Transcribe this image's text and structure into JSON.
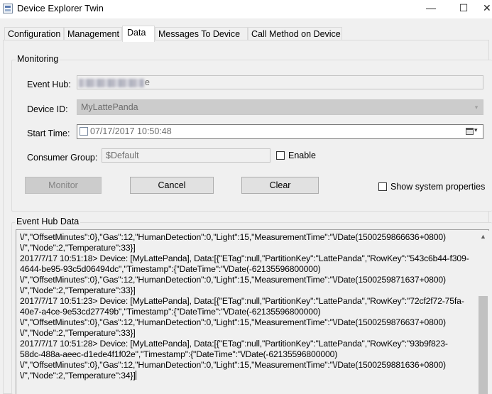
{
  "window": {
    "title": "Device Explorer Twin",
    "minimize": "—",
    "maximize": "☐",
    "close": "✕"
  },
  "tabs": [
    {
      "label": "Configuration",
      "active": false
    },
    {
      "label": "Management",
      "active": false
    },
    {
      "label": "Data",
      "active": true
    },
    {
      "label": "Messages To Device",
      "active": false
    },
    {
      "label": "Call Method on Device",
      "active": false
    }
  ],
  "monitoring": {
    "group_title": "Monitoring",
    "event_hub_label": "Event Hub:",
    "event_hub_value_suffix": "e",
    "device_id_label": "Device ID:",
    "device_id_value": "MyLattePanda",
    "start_time_label": "Start Time:",
    "start_time_value": "07/17/2017 10:50:48",
    "start_time_checked": false,
    "consumer_group_label": "Consumer Group:",
    "consumer_group_value": "$Default",
    "enable_label": "Enable",
    "enable_checked": false,
    "monitor_button": "Monitor",
    "cancel_button": "Cancel",
    "clear_button": "Clear",
    "show_system_properties_label": "Show system properties",
    "show_system_properties_checked": false
  },
  "event_hub_data": {
    "group_title": "Event Hub Data",
    "lines": [
      "\\/\",\"OffsetMinutes\":0},\"Gas\":12,\"HumanDetection\":0,\"Light\":15,\"MeasurementTime\":\"\\/Date(1500259866636+0800)",
      "\\/\",\"Node\":2,\"Temperature\":33}]",
      "2017/7/17 10:51:18> Device: [MyLattePanda], Data:[{\"ETag\":null,\"PartitionKey\":\"LattePanda\",\"RowKey\":\"543c6b44-f309-",
      "4644-be95-93c5d06494dc\",\"Timestamp\":{\"DateTime\":\"\\/Date(-62135596800000)",
      "\\/\",\"OffsetMinutes\":0},\"Gas\":12,\"HumanDetection\":0,\"Light\":15,\"MeasurementTime\":\"\\/Date(1500259871637+0800)",
      "\\/\",\"Node\":2,\"Temperature\":33}]",
      "2017/7/17 10:51:23> Device: [MyLattePanda], Data:[{\"ETag\":null,\"PartitionKey\":\"LattePanda\",\"RowKey\":\"72cf2f72-75fa-",
      "40e7-a4ce-9e53cd27749b\",\"Timestamp\":{\"DateTime\":\"\\/Date(-62135596800000)",
      "\\/\",\"OffsetMinutes\":0},\"Gas\":12,\"HumanDetection\":0,\"Light\":15,\"MeasurementTime\":\"\\/Date(1500259876637+0800)",
      "\\/\",\"Node\":2,\"Temperature\":33}]",
      "2017/7/17 10:51:28> Device: [MyLattePanda], Data:[{\"ETag\":null,\"PartitionKey\":\"LattePanda\",\"RowKey\":\"93b9f823-",
      "58dc-488a-aeec-d1ede4f1f02e\",\"Timestamp\":{\"DateTime\":\"\\/Date(-62135596800000)",
      "\\/\",\"OffsetMinutes\":0},\"Gas\":12,\"HumanDetection\":0,\"Light\":15,\"MeasurementTime\":\"\\/Date(1500259881636+0800)",
      "\\/\",\"Node\":2,\"Temperature\":34}]"
    ]
  },
  "icons": {
    "dropdown": "▾",
    "scroll_up": "▲"
  }
}
